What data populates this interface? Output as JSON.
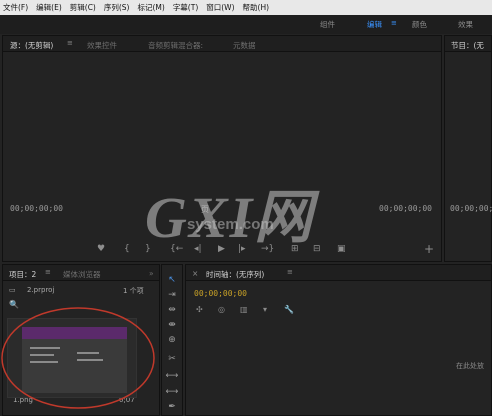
{
  "menu": [
    "文件(F)",
    "编辑(E)",
    "剪辑(C)",
    "序列(S)",
    "标记(M)",
    "字幕(T)",
    "窗口(W)",
    "帮助(H)"
  ],
  "workspace": {
    "tabs": [
      "组件",
      "编辑",
      "颜色",
      "效果"
    ],
    "menu_glyph": "≡"
  },
  "source_panel": {
    "tabs": [
      "源：(无剪辑)",
      "效果控件",
      "音频剪辑混合器:",
      "元数据"
    ],
    "menu_glyph": "≡",
    "timecode_left": "00;00;00;00",
    "timecode_center": "页",
    "timecode_right": "00;00;00;00"
  },
  "program_panel": {
    "tab": "节目：(无",
    "timecode": "00;00;00;00"
  },
  "watermark": {
    "big": "GXI网",
    "small": "system.com"
  },
  "transport": {
    "marker": "♥",
    "in": "{",
    "out": "}",
    "goto_in": "{←",
    "step_back": "◂|",
    "play": "▶",
    "step_fwd": "|▸",
    "goto_out": "→}",
    "insert": "⊞",
    "overwrite": "⊟",
    "export": "▣",
    "add": "+"
  },
  "project_panel": {
    "tabs": [
      "项目：2",
      "媒体浏览器"
    ],
    "more": "»",
    "menu_glyph": "≡",
    "project_file": "2.prproj",
    "item_count": "1 个项",
    "clip_name": "1.png",
    "clip_duration": "0;07",
    "search": "🔍"
  },
  "timeline_panel": {
    "close": "×",
    "title": "时间轴：(无序列)",
    "menu_glyph": "≡",
    "timecode": "00;00;00;00",
    "hint": "在此处放"
  },
  "tools": [
    "↖",
    "⇥",
    "⇹",
    "⇼",
    "⊕",
    "✂",
    "⟷",
    "⟷",
    "✒"
  ]
}
